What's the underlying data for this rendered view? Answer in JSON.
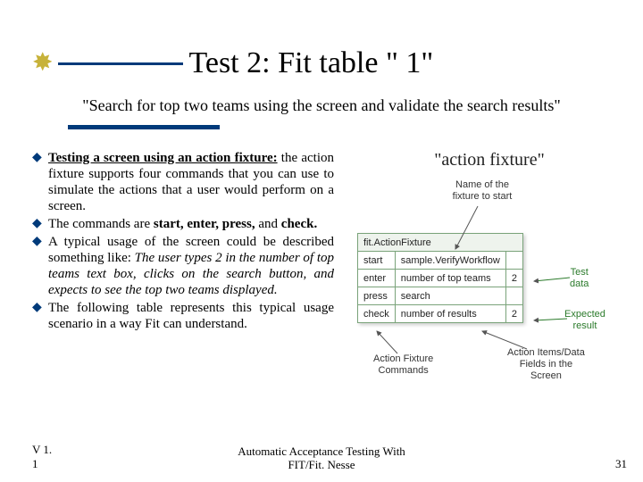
{
  "title": "Test 2: Fit table \" 1\"",
  "subtitle": "\"Search for top two teams using the screen and validate the search results\"",
  "bullets": {
    "b1": {
      "lead": "Testing a screen using an action fixture:",
      "rest": " the action fixture supports four commands that you can use to simulate the actions that a user would perform on a screen."
    },
    "b2": {
      "pre": "The commands are ",
      "cmds": "start, enter, press,",
      "mid": " and ",
      "last": "check."
    },
    "b3": {
      "pre": "A typical usage of the screen could be described something like: ",
      "ital": "The user types 2 in the number of top teams text box, clicks on the search button, and expects to see the top two teams displayed."
    },
    "b4": "The following table represents this typical usage scenario in a way Fit can understand."
  },
  "caption": "\"action fixture\"",
  "diagram": {
    "note_top": "Name of the\nfixture to start",
    "note_test_data": "Test\ndata",
    "note_expected": "Expected\nresult",
    "note_cmds": "Action Fixture\nCommands",
    "note_items": "Action Items/Data\nFields in the\nScreen",
    "rows": {
      "header": "fit.ActionFixture",
      "r1": {
        "c1": "start",
        "c2": "sample.VerifyWorkflow",
        "c3": ""
      },
      "r2": {
        "c1": "enter",
        "c2": "number of top teams",
        "c3": "2"
      },
      "r3": {
        "c1": "press",
        "c2": "search",
        "c3": ""
      },
      "r4": {
        "c1": "check",
        "c2": "number of results",
        "c3": "2"
      }
    }
  },
  "footer": {
    "version": "V 1. 1",
    "center1": "Automatic Acceptance Testing With",
    "center2": "FIT/Fit. Nesse",
    "page": "31"
  }
}
